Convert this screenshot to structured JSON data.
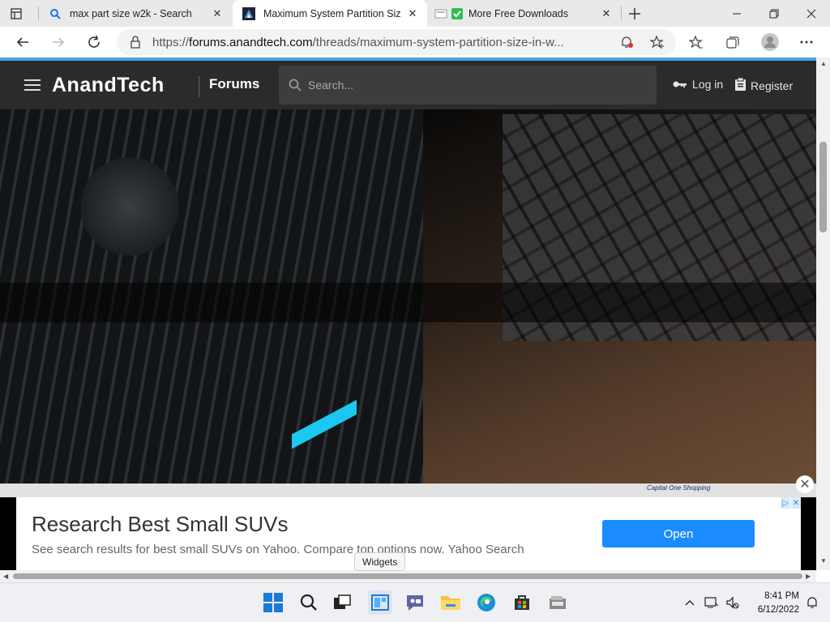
{
  "browser": {
    "tabs": [
      {
        "title": "max part size w2k - Search",
        "favicon": "search-favicon",
        "active": false
      },
      {
        "title": "Maximum System Partition Size i",
        "favicon": "anandtech-favicon",
        "active": true
      },
      {
        "title": "More Free Downloads",
        "favicon": "green-check-favicon",
        "active": false
      }
    ],
    "url_prefix": "https://",
    "url_host": "forums.anandtech.com",
    "url_path": "/threads/maximum-system-partition-size-in-w..."
  },
  "site": {
    "logo": "AnandTech",
    "section": "Forums",
    "search_placeholder": "Search...",
    "login": "Log in",
    "register": "Register",
    "accent_color": "#4aa3df"
  },
  "ad": {
    "strip_text": "Capital One Shopping",
    "title": "Research Best Small SUVs",
    "description": "See search results for best small SUVs on Yahoo. Compare top options now. Yahoo Search",
    "button": "Open",
    "button_color": "#1a8cff"
  },
  "tooltip": "Widgets",
  "taskbar": {
    "time": "8:41 PM",
    "date": "6/12/2022",
    "icons": [
      "start-icon",
      "search-icon",
      "task-view-icon",
      "widgets-icon",
      "chat-icon",
      "file-explorer-icon",
      "edge-icon",
      "store-icon",
      "app-icon"
    ]
  }
}
